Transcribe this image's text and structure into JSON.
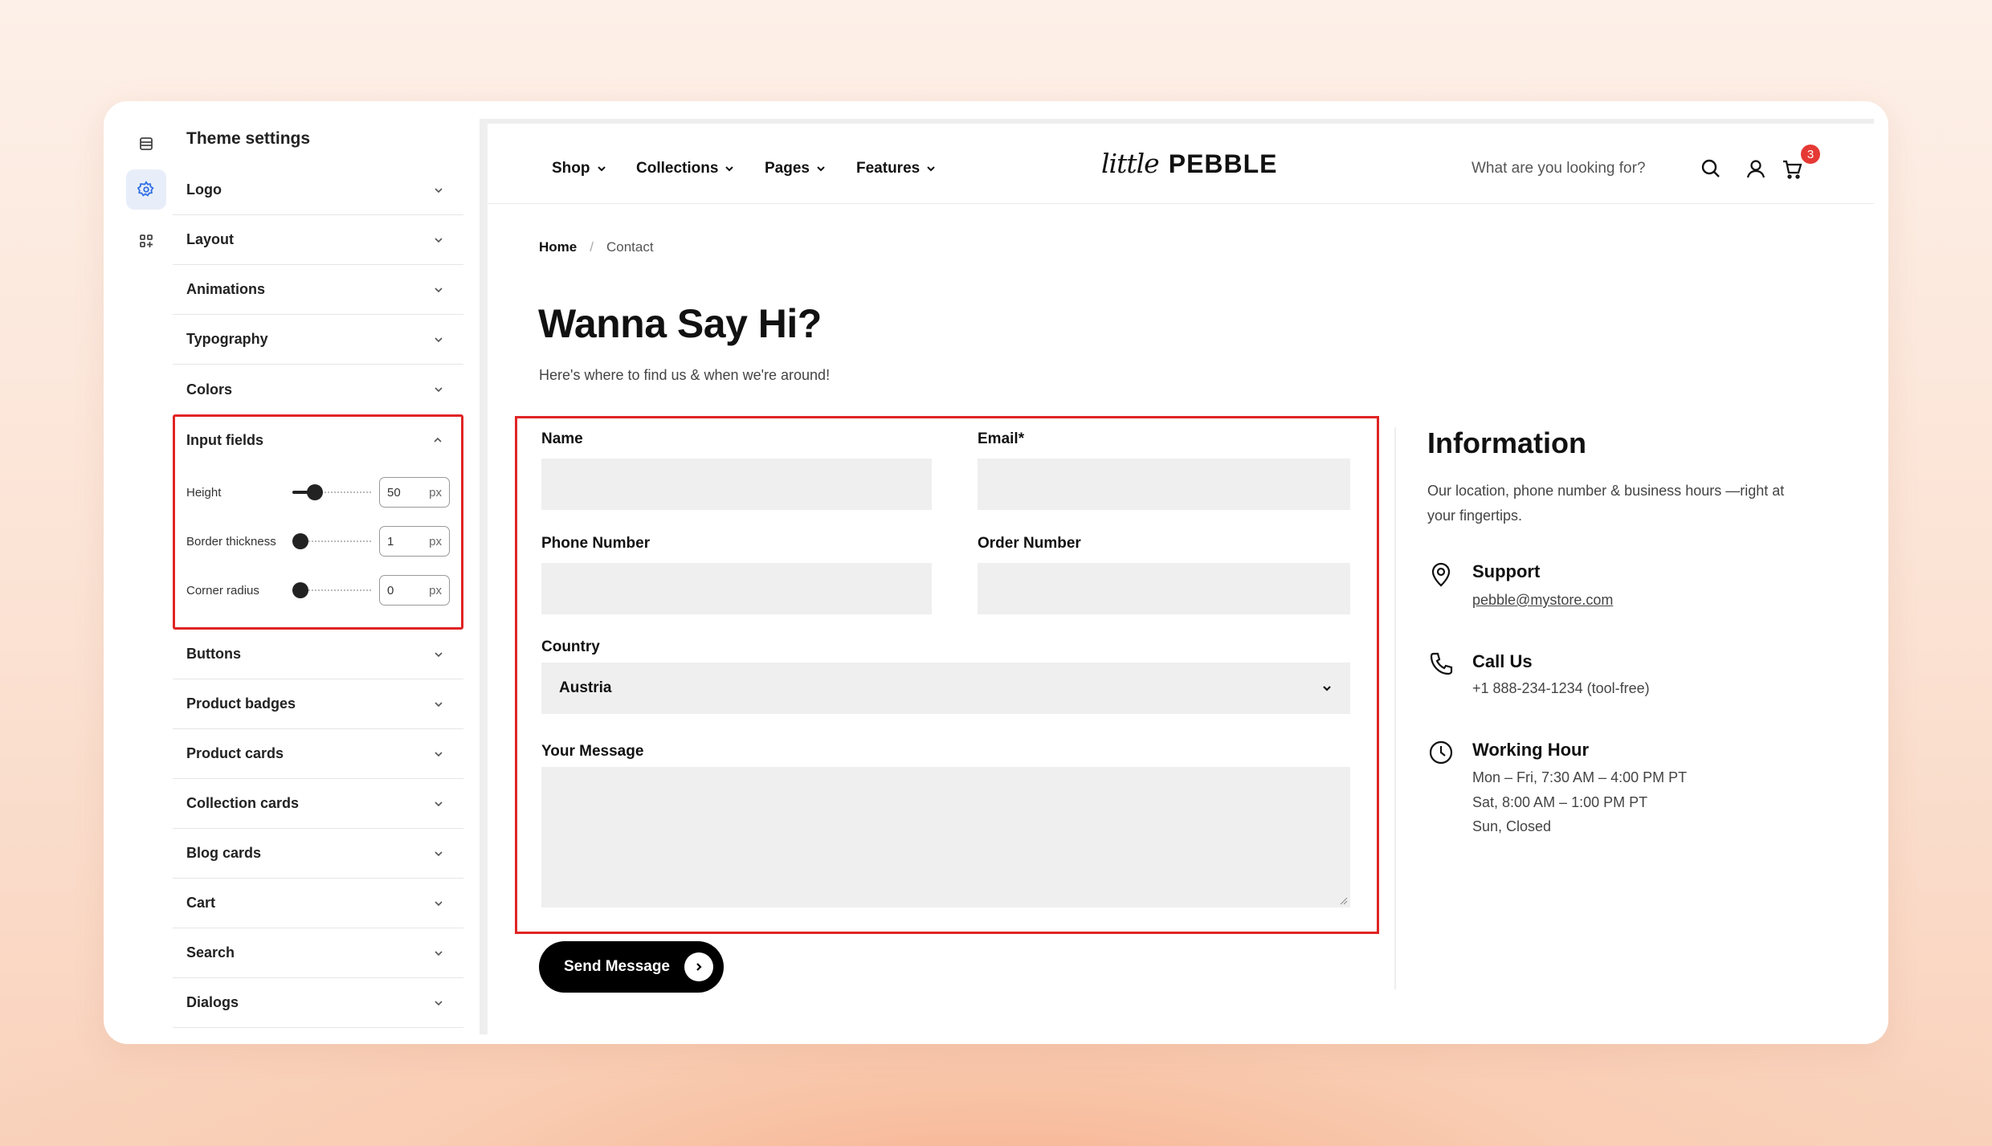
{
  "sidebar": {
    "title": "Theme settings",
    "items_top": [
      "Logo",
      "Layout",
      "Animations",
      "Typography",
      "Colors"
    ],
    "open_section": {
      "label": "Input fields",
      "controls": [
        {
          "label": "Height",
          "value": "50",
          "unit": "px",
          "level": 0.25
        },
        {
          "label": "Border thickness",
          "value": "1",
          "unit": "px",
          "level": 0
        },
        {
          "label": "Corner radius",
          "value": "0",
          "unit": "px",
          "level": 0
        }
      ]
    },
    "items_bottom": [
      "Buttons",
      "Product badges",
      "Product cards",
      "Collection cards",
      "Blog cards",
      "Cart",
      "Search",
      "Dialogs"
    ]
  },
  "nav": {
    "items": [
      "Shop",
      "Collections",
      "Pages",
      "Features"
    ],
    "logo_script": "little",
    "logo_word": "PEBBLE",
    "search_placeholder": "What are you looking for?",
    "cart_count": "3"
  },
  "breadcrumb": {
    "home": "Home",
    "separator": "/",
    "current": "Contact"
  },
  "page": {
    "title": "Wanna Say Hi?",
    "subtitle": "Here's where to find us & when we're around!"
  },
  "form": {
    "name_label": "Name",
    "email_label": "Email*",
    "phone_label": "Phone Number",
    "order_label": "Order Number",
    "country_label": "Country",
    "country_value": "Austria",
    "message_label": "Your Message",
    "submit_label": "Send Message"
  },
  "info": {
    "title": "Information",
    "subtitle": "Our location, phone number & business hours —right at your fingertips.",
    "support_title": "Support",
    "support_email": "pebble@mystore.com",
    "call_title": "Call Us",
    "call_number": "+1 888-234-1234 (tool-free)",
    "hours_title": "Working Hour",
    "hours_lines": [
      "Mon – Fri, 7:30 AM – 4:00 PM PT",
      "Sat, 8:00 AM – 1:00 PM PT",
      "Sun, Closed"
    ]
  },
  "colors": {
    "accent": "#2f6fe4",
    "highlight": "#e02424",
    "badge": "#e53935"
  }
}
